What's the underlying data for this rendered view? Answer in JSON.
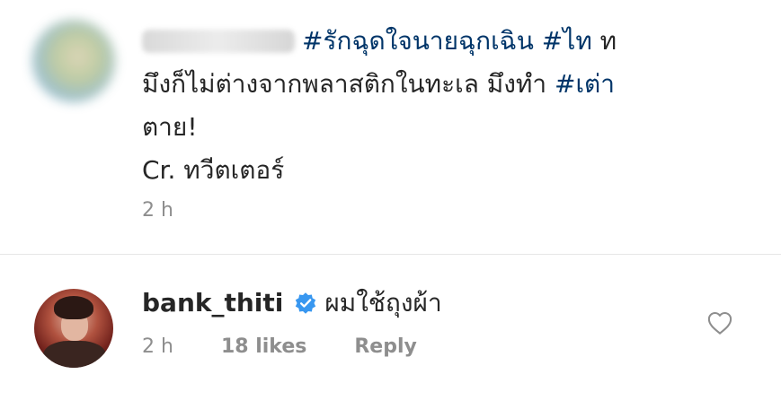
{
  "comment1": {
    "line1_hashtag1": "#รักฉุดใจนายฉุกเฉิน",
    "line1_hashtag2": "#ไท",
    "line1_tail": " ท",
    "line2_text": "มึงก็ไม่ต่างจากพลาสติกในทะเล มึงทำ ",
    "line2_hashtag": "#เต่า",
    "line3": "ตาย!",
    "line4": "Cr. ทวีตเตอร์",
    "time": "2 h"
  },
  "comment2": {
    "username": "bank_thiti",
    "text": "ผมใช้ถุงผ้า",
    "time": "2 h",
    "likes": "18 likes",
    "reply_label": "Reply"
  },
  "colors": {
    "hashtag": "#003569",
    "verified": "#3897f0",
    "meta": "#8e8e8e"
  },
  "icons": {
    "verified": "verified-badge-icon",
    "like": "heart-icon"
  }
}
